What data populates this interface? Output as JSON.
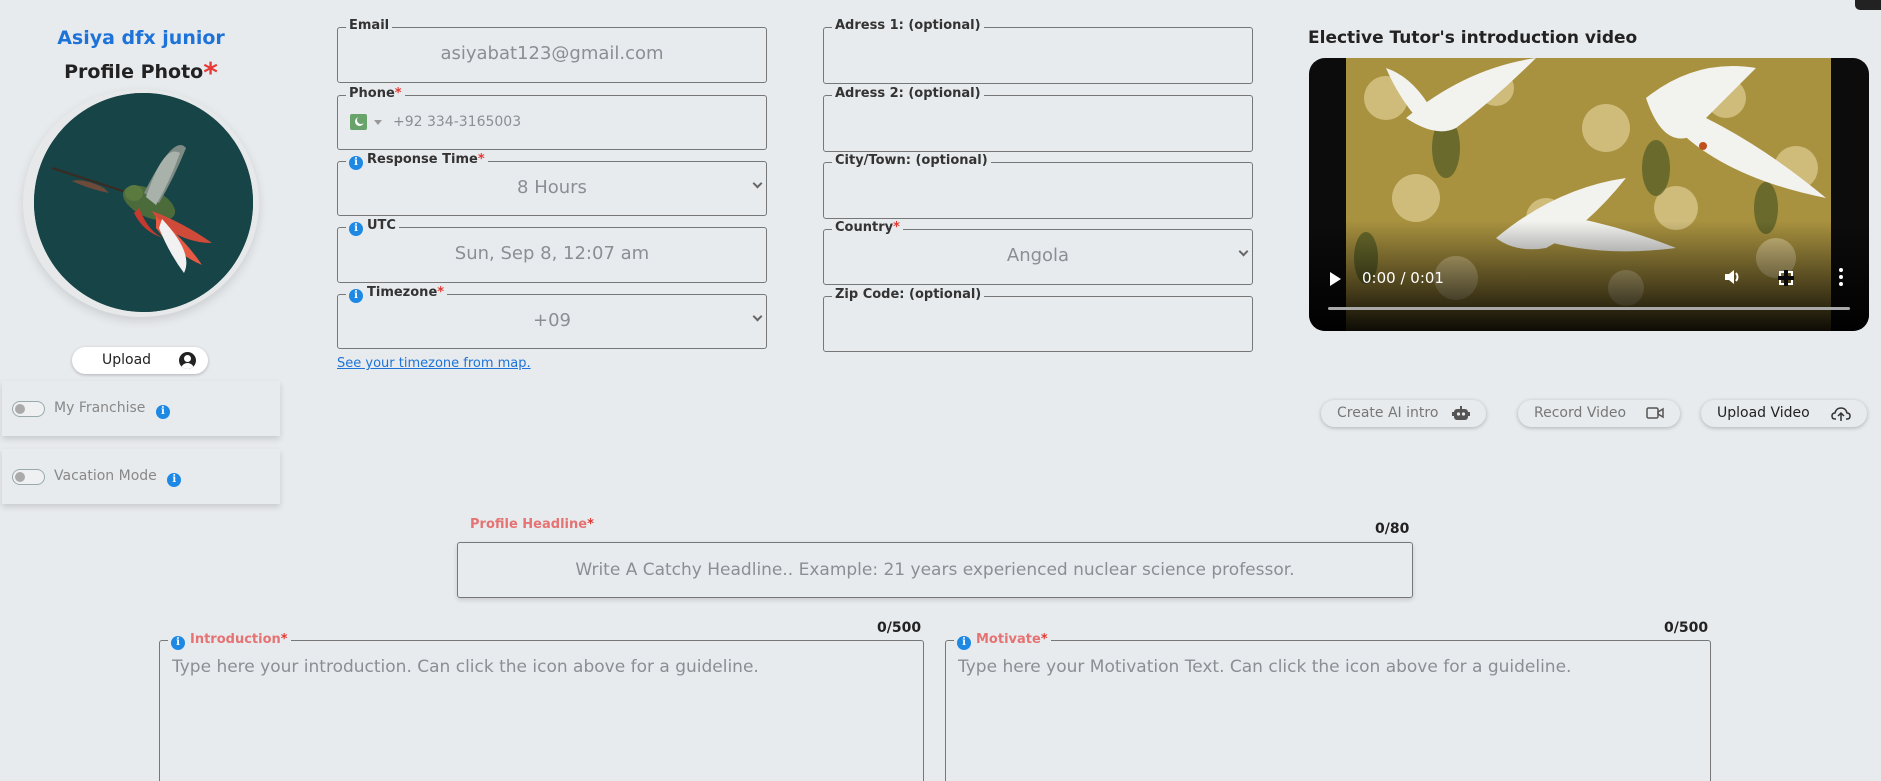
{
  "profile": {
    "user_name": "Asiya dfx junior",
    "photo_label": "Profile Photo",
    "required_mark": "*",
    "upload_label": "Upload"
  },
  "toggles": {
    "franchise_label": "My Franchise",
    "vacation_label": "Vacation Mode",
    "franchise_on": false,
    "vacation_on": false
  },
  "fields": {
    "email_label": "Email",
    "email_value": "asiyabat123@gmail.com",
    "phone_label": "Phone",
    "phone_value": "+92 334-3165003",
    "response_label": "Response Time",
    "response_value": "8 Hours",
    "utc_label": "UTC",
    "utc_value": "Sun, Sep 8, 12:07 am",
    "timezone_label": "Timezone",
    "timezone_value": "+09",
    "timezone_link": "See your timezone from map.",
    "addr1_label": "Adress 1: (optional)",
    "addr2_label": "Adress 2: (optional)",
    "city_label": "City/Town: (optional)",
    "country_label": "Country",
    "country_value": "Angola",
    "zip_label": "Zip Code: (optional)"
  },
  "video": {
    "title": "Elective Tutor's introduction video",
    "time": "0:00 / 0:01",
    "btn_ai": "Create AI intro",
    "btn_record": "Record Video",
    "btn_upload": "Upload Video"
  },
  "headline": {
    "label": "Profile Headline",
    "count": "0/80",
    "placeholder": "Write A Catchy Headline.. Example: 21 years experienced nuclear science professor."
  },
  "introduction": {
    "label": "Introduction",
    "count": "0/500",
    "placeholder": "Type here your introduction. Can click the icon above for a guideline."
  },
  "motivate": {
    "label": "Motivate",
    "count": "0/500",
    "placeholder": "Type here your Motivation Text. Can click the icon above for a guideline."
  },
  "info_glyph": "i",
  "colors": {
    "accent_blue": "#1e73d8",
    "required_red": "#e53935",
    "label_red": "#e57373",
    "background": "#e8ebee"
  }
}
